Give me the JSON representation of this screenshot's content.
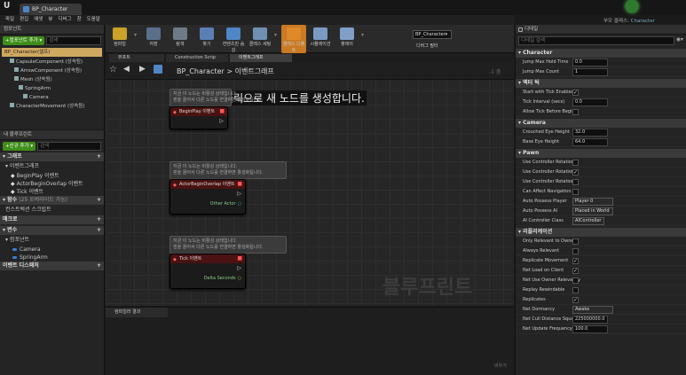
{
  "app": {
    "tab_title": "BP_Character",
    "right_label": "부모 클래스:",
    "parent_class": "Character"
  },
  "menu": [
    "파일",
    "편집",
    "애셋",
    "뷰",
    "디버그",
    "창",
    "도움말"
  ],
  "components": {
    "title": "컴포넌트",
    "add_label": "+컴포넌트 추가 ▾",
    "search_placeholder": "검색",
    "root": "BP_Character(셀프)",
    "items": [
      {
        "label": "CapsuleComponent (상속됨)",
        "indent": 1
      },
      {
        "label": "ArrowComponent (상속됨)",
        "indent": 2
      },
      {
        "label": "Mesh (상속됨)",
        "indent": 2
      },
      {
        "label": "SpringArm",
        "indent": 3
      },
      {
        "label": "Camera",
        "indent": 4
      },
      {
        "label": "CharacterMovement (상속됨)",
        "indent": 1
      }
    ]
  },
  "mybp": {
    "title": "내 블루프린트",
    "add_label": "+신규 추가 ▾",
    "search_placeholder": "검색",
    "graphs_header": "그래프",
    "event_graph": "이벤트그래프",
    "events": [
      "BeginPlay 이벤트",
      "ActorBeginOverlap 이벤트",
      "Tick 이벤트"
    ],
    "functions_header": "함수",
    "functions_sub": "(25 오버라이드 가능)",
    "construction": "컨스트럭션 스크립트",
    "macros": "매크로",
    "variables": "변수",
    "components_cat": "컴포넌트",
    "vars": [
      "Camera",
      "SpringArm"
    ],
    "dispatchers": "이벤트 디스패처"
  },
  "toolbar": [
    {
      "label": "컴파일",
      "color": "#c9a227"
    },
    {
      "label": "저장",
      "color": "#5a6f8a"
    },
    {
      "label": "탐색",
      "color": "#6e7a87"
    },
    {
      "label": "찾기",
      "color": "#5b7fb5"
    },
    {
      "label": "컨텐츠만 숨김",
      "color": "#4f86c6"
    },
    {
      "label": "클래스 세팅",
      "color": "#6f8fb3"
    },
    {
      "label": "클래스 디폴트",
      "color": "#e0892a"
    },
    {
      "label": "시뮬레이션",
      "color": "#7a9ac2"
    },
    {
      "label": "플레이",
      "color": "#7f9fc8"
    }
  ],
  "debug": {
    "value": "BP_Character▾",
    "label": "디버그 필터"
  },
  "tabs": {
    "viewport": "뷰포트",
    "construction": "Construction Scrip",
    "event_graph": "이벤트그래프"
  },
  "graph": {
    "breadcrumb_root": "BP_Character",
    "breadcrumb_sep": ">",
    "breadcrumb_leaf": "이벤트그래프",
    "zoom": "-1 줌",
    "hint": "우클릭으로 새 노드를 생성합니다.",
    "watermark": "블루프린트",
    "comment_text": "지금 이 노드는 비활성 상태입니다.\n핀을 끌어서 다른 노드를 연결하면 활성화됩니다.",
    "nodes": [
      {
        "title": "BeginPlay 이벤트",
        "pin": ""
      },
      {
        "title": "ActorBeginOverlap 이벤트",
        "pin": "Other Actor"
      },
      {
        "title": "Tick 이벤트",
        "pin": "Delta Seconds"
      }
    ]
  },
  "compiler": {
    "title": "컴파일러 결과",
    "clear": "비우기"
  },
  "details": {
    "title": "디테일",
    "search_placeholder": "디테일 검색",
    "sections": [
      {
        "name": "Character",
        "rows": [
          {
            "label": "Jump Max Hold Time",
            "type": "num",
            "value": "0.0"
          },
          {
            "label": "Jump Max Count",
            "type": "num",
            "value": "1"
          }
        ]
      },
      {
        "name": "액터 틱",
        "rows": [
          {
            "label": "Start with Tick Enabled",
            "type": "chk",
            "on": true
          },
          {
            "label": "Tick Interval (secs)",
            "type": "num",
            "value": "0.0"
          },
          {
            "label": "Allow Tick Before Begin",
            "type": "chk",
            "on": false
          }
        ]
      },
      {
        "name": "Camera",
        "rows": [
          {
            "label": "Crouched Eye Height",
            "type": "num",
            "value": "32.0"
          },
          {
            "label": "Base Eye Height",
            "type": "num",
            "value": "64.0"
          }
        ]
      },
      {
        "name": "Pawn",
        "rows": [
          {
            "label": "Use Controller Rotation P",
            "type": "chk",
            "on": false
          },
          {
            "label": "Use Controller Rotation Y",
            "type": "chk",
            "on": true
          },
          {
            "label": "Use Controller Rotation R",
            "type": "chk",
            "on": false
          },
          {
            "label": "Can Affect Navigation G",
            "type": "chk",
            "on": false
          },
          {
            "label": "Auto Possess Player",
            "type": "dd",
            "value": "Player 0"
          },
          {
            "label": "Auto Possess AI",
            "type": "dd",
            "value": "Placed in World"
          },
          {
            "label": "AI Controller Class",
            "type": "dd",
            "value": "AIController"
          }
        ]
      },
      {
        "name": "리플리케이션",
        "rows": [
          {
            "label": "Only Relevant to Owner",
            "type": "chk",
            "on": false
          },
          {
            "label": "Always Relevant",
            "type": "chk",
            "on": false
          },
          {
            "label": "Replicate Movement",
            "type": "chk",
            "on": true
          },
          {
            "label": "Net Load on Client",
            "type": "chk",
            "on": true
          },
          {
            "label": "Net Use Owner Relevancy",
            "type": "chk",
            "on": false
          },
          {
            "label": "Replay Rewindable",
            "type": "chk",
            "on": false
          },
          {
            "label": "Replicates",
            "type": "chk",
            "on": true
          },
          {
            "label": "Net Dormancy",
            "type": "dd",
            "value": "Awake"
          },
          {
            "label": "Net Cull Distance Squar",
            "type": "num",
            "value": "225000000.0"
          },
          {
            "label": "Net Update Frequency",
            "type": "num",
            "value": "100.0"
          }
        ]
      }
    ]
  }
}
